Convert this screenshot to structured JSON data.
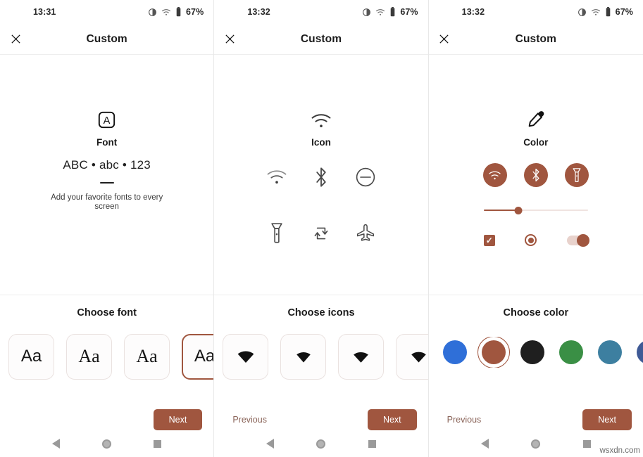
{
  "theme": {
    "accent": "#a0563f",
    "accent_light": "#f0e3e0",
    "prev_link_color": "#8a6459"
  },
  "watermark": "wsxdn.com",
  "panels": [
    {
      "statusbar": {
        "time": "13:31",
        "battery": "67%",
        "icons": [
          "brightness-icon",
          "wifi-icon",
          "battery-icon"
        ]
      },
      "appbar": {
        "close": "close-icon",
        "title": "Custom"
      },
      "preview": {
        "hero_icon": "font-box-icon",
        "label": "Font",
        "sample": "ABC • abc • 123",
        "description": "Add your favorite fonts to every screen"
      },
      "chooser": {
        "title": "Choose font",
        "cards": [
          {
            "label": "Aa",
            "style": "sans",
            "selected": false
          },
          {
            "label": "Aa",
            "style": "serif",
            "selected": false
          },
          {
            "label": "Aa",
            "style": "serif",
            "selected": false
          },
          {
            "label": "Aa",
            "style": "sans",
            "selected": true
          }
        ],
        "previous_label": "",
        "next_label": "Next",
        "show_previous": false
      }
    },
    {
      "statusbar": {
        "time": "13:32",
        "battery": "67%",
        "icons": [
          "brightness-icon",
          "wifi-icon",
          "battery-icon"
        ]
      },
      "appbar": {
        "close": "close-icon",
        "title": "Custom"
      },
      "preview": {
        "hero_icon": "wifi-icon",
        "label": "Icon",
        "grid_icons": [
          "wifi-icon",
          "bluetooth-icon",
          "do-not-disturb-icon",
          "flashlight-icon",
          "rotate-icon",
          "airplane-icon"
        ]
      },
      "chooser": {
        "title": "Choose icons",
        "cards": [
          {
            "label": "wifi-filled-icon",
            "selected": false
          },
          {
            "label": "wifi-filled-icon",
            "selected": false
          },
          {
            "label": "wifi-filled-icon",
            "selected": false
          },
          {
            "label": "wifi-filled-icon",
            "selected": false
          }
        ],
        "previous_label": "Previous",
        "next_label": "Next",
        "show_previous": true
      }
    },
    {
      "statusbar": {
        "time": "13:32",
        "battery": "67%",
        "icons": [
          "brightness-icon",
          "wifi-icon",
          "battery-icon"
        ]
      },
      "appbar": {
        "close": "close-icon",
        "title": "Custom"
      },
      "preview": {
        "hero_icon": "eyedropper-icon",
        "label": "Color",
        "chip_icons": [
          "wifi-icon",
          "bluetooth-icon",
          "flashlight-icon"
        ],
        "slider_value": 33,
        "checkbox_checked": true,
        "radio_selected": true,
        "switch_on": true
      },
      "chooser": {
        "title": "Choose color",
        "swatches": [
          {
            "color": "#2f6fd8",
            "selected": false
          },
          {
            "color": "#a0563f",
            "selected": true
          },
          {
            "color": "#1f1f1f",
            "selected": false
          },
          {
            "color": "#3a8f45",
            "selected": false
          },
          {
            "color": "#3d7fa0",
            "selected": false
          },
          {
            "color": "#3f5a96",
            "selected": false
          }
        ],
        "previous_label": "Previous",
        "next_label": "Next",
        "show_previous": true
      }
    }
  ],
  "sysnav": {
    "back": "back-triangle-icon",
    "home": "home-circle-icon",
    "recents": "recents-square-icon"
  }
}
